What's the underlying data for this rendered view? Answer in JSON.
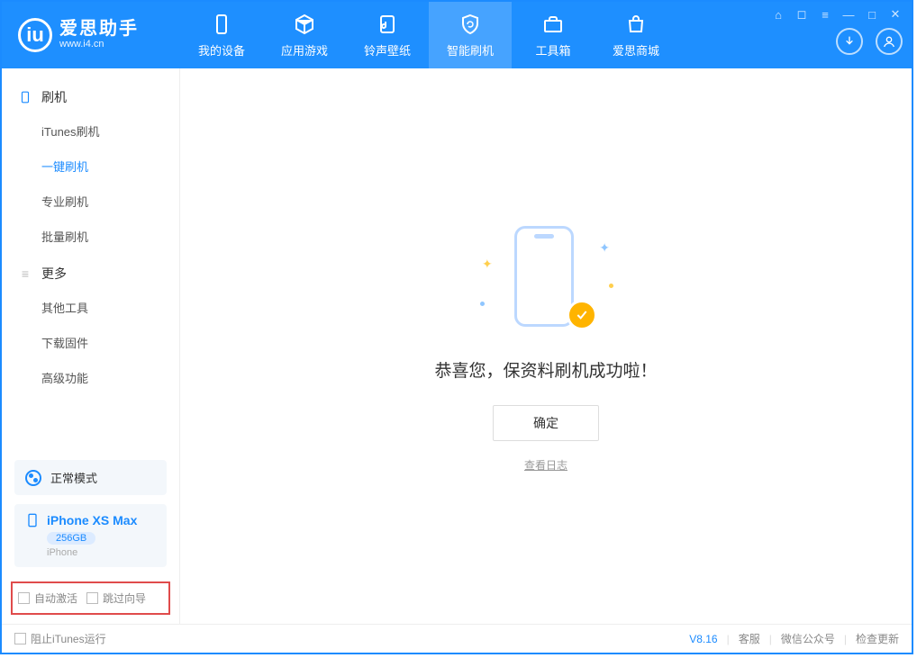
{
  "app": {
    "name_cn": "爱思助手",
    "name_en": "www.i4.cn"
  },
  "nav": {
    "tabs": [
      {
        "label": "我的设备"
      },
      {
        "label": "应用游戏"
      },
      {
        "label": "铃声壁纸"
      },
      {
        "label": "智能刷机"
      },
      {
        "label": "工具箱"
      },
      {
        "label": "爱思商城"
      }
    ]
  },
  "sidebar": {
    "group_flash": "刷机",
    "items_flash": [
      {
        "label": "iTunes刷机"
      },
      {
        "label": "一键刷机"
      },
      {
        "label": "专业刷机"
      },
      {
        "label": "批量刷机"
      }
    ],
    "group_more": "更多",
    "items_more": [
      {
        "label": "其他工具"
      },
      {
        "label": "下载固件"
      },
      {
        "label": "高级功能"
      }
    ],
    "mode_label": "正常模式",
    "device": {
      "name": "iPhone XS Max",
      "storage": "256GB",
      "type": "iPhone"
    },
    "opt_auto_activate": "自动激活",
    "opt_skip_guide": "跳过向导"
  },
  "main": {
    "success_msg": "恭喜您，保资料刷机成功啦！",
    "ok_label": "确定",
    "view_log": "查看日志"
  },
  "status": {
    "block_itunes": "阻止iTunes运行",
    "version": "V8.16",
    "support": "客服",
    "wechat": "微信公众号",
    "update": "检查更新"
  }
}
